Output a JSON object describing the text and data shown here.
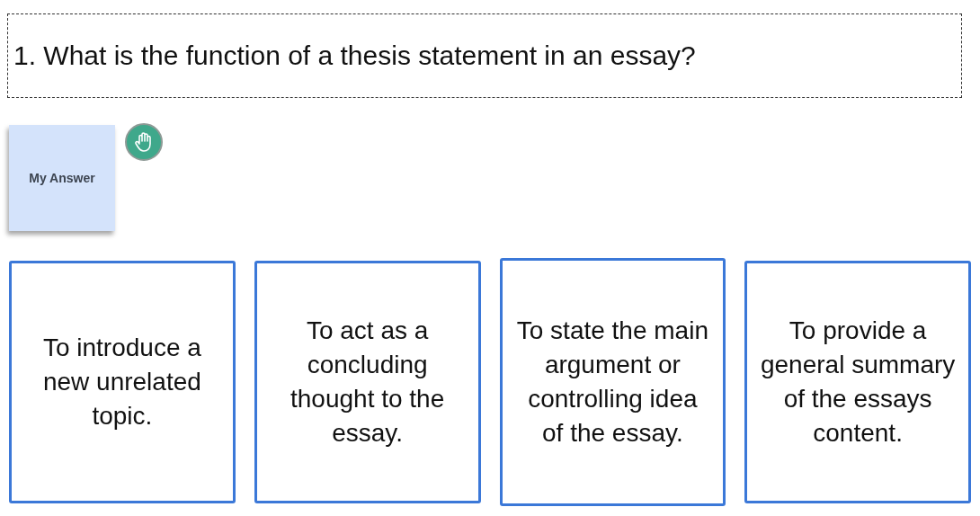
{
  "question": {
    "text": "1. What is the function of a thesis statement in an essay?"
  },
  "answer_note": {
    "label": "My Answer"
  },
  "options": [
    {
      "text": "To introduce a new unrelated topic."
    },
    {
      "text": "To act as a concluding thought to the essay."
    },
    {
      "text": "To state the main argument or controlling idea of the essay."
    },
    {
      "text": "To provide a general summary of the essays content."
    }
  ]
}
